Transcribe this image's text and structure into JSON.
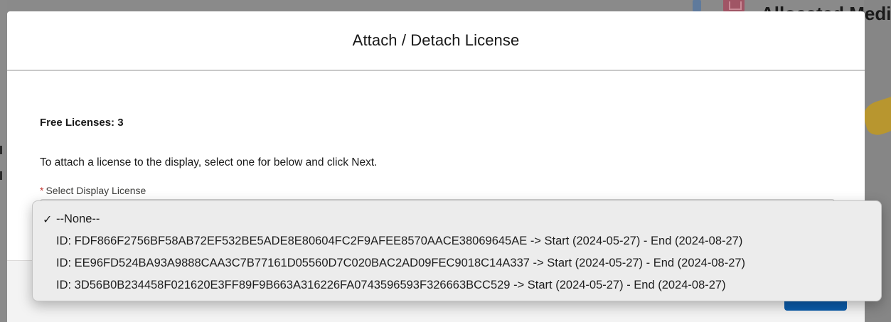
{
  "background": {
    "account_name": "Allocated Medias"
  },
  "modal": {
    "title": "Attach / Detach License",
    "free_licenses": "Free Licenses: 3",
    "instructions": "To attach a license to the display, select one for below and click Next.",
    "field_label": "Select Display License",
    "required_marker": "*"
  },
  "dropdown": {
    "checkmark": "✓",
    "options": [
      {
        "label": "--None--",
        "selected": true
      },
      {
        "label": "ID: FDF866F2756BF58AB72EF532BE5ADE8E80604FC2F9AFEE8570AACE38069645AE -> Start (2024-05-27) - End (2024-08-27)",
        "selected": false
      },
      {
        "label": "ID: EE96FD524BA93A9888CAA3C7B77161D05560D7C020BAC2AD09FEC9018C14A337 -> Start (2024-05-27) - End (2024-08-27)",
        "selected": false
      },
      {
        "label": "ID: 3D56B0B234458F021620E3FF89F9B663A316226FA0743596593F326663BCC529 -> Start (2024-05-27) - End (2024-08-27)",
        "selected": false
      }
    ]
  },
  "colors": {
    "brand_button": "#0b5cab",
    "required": "#c23934"
  }
}
